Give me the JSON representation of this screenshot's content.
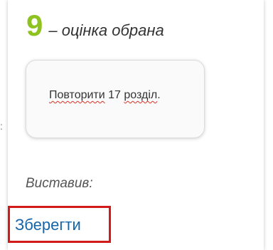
{
  "grade": {
    "value": "9",
    "caption": "– оцінка обрана",
    "color": "#8dc21f"
  },
  "comment": {
    "before": "Повторити",
    "middle": " 17 ",
    "after": "розділ",
    "period": "."
  },
  "left_gutter_mark": ":",
  "posted_by_label": "Виставив:",
  "save": {
    "label": "Зберегти",
    "highlight_color": "#d11a1a",
    "label_color": "#1565a8"
  }
}
